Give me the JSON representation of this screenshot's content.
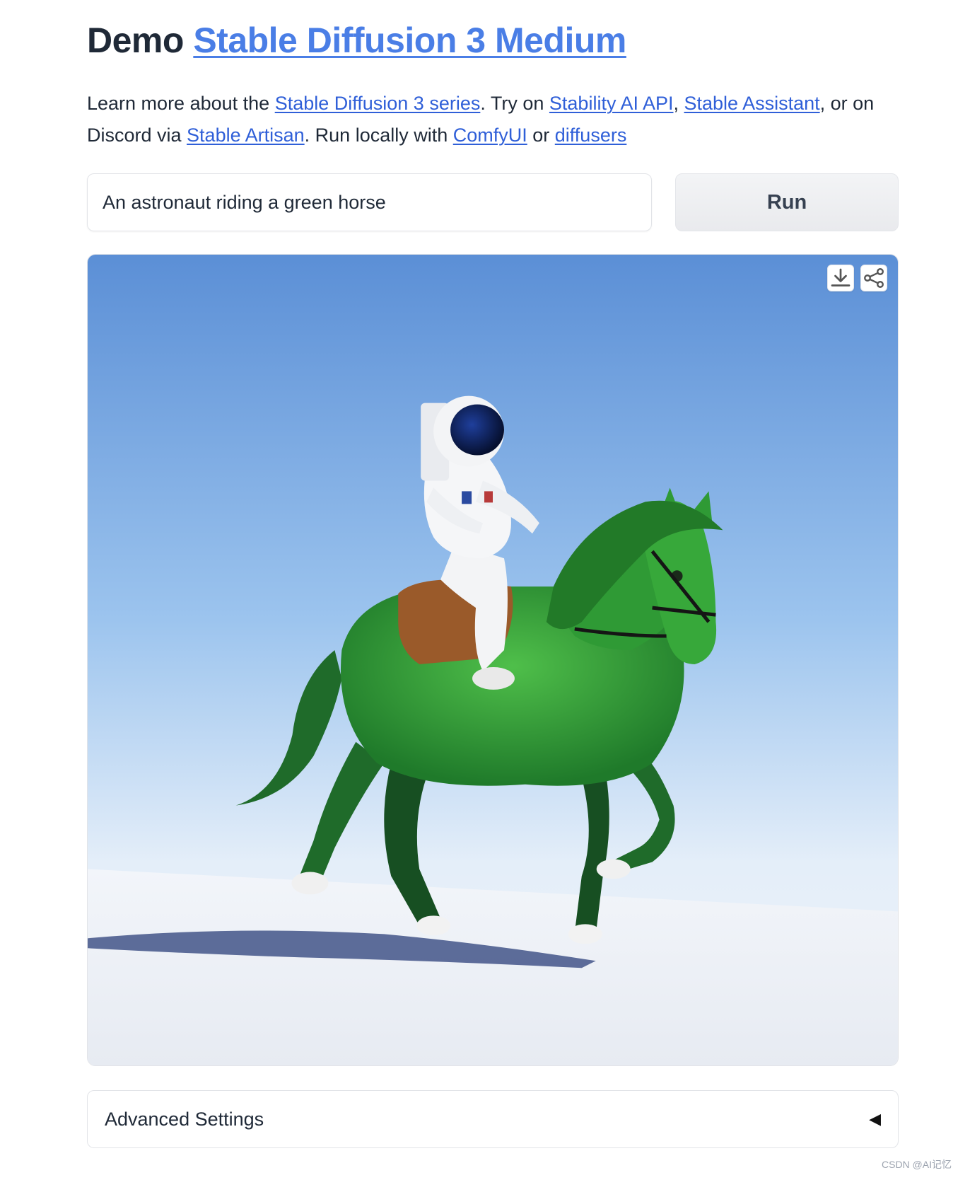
{
  "header": {
    "prefix": "Demo ",
    "link_label": "Stable Diffusion 3 Medium"
  },
  "intro": {
    "t1": "Learn more about the ",
    "link_series": "Stable Diffusion 3 series",
    "t2": ". Try on ",
    "link_api": "Stability AI API",
    "t3": ", ",
    "link_assistant": "Stable Assistant",
    "t4": ", or on Discord via ",
    "link_artisan": "Stable Artisan",
    "t5": ". Run locally with ",
    "link_comfy": "ComfyUI",
    "t6": " or ",
    "link_diffusers": "diffusers"
  },
  "prompt": {
    "value": "An astronaut riding a green horse"
  },
  "run_button": {
    "label": "Run"
  },
  "result": {
    "download_icon": "download-icon",
    "share_icon": "share-icon"
  },
  "advanced_settings": {
    "label": "Advanced Settings",
    "caret": "◀"
  },
  "watermark": "CSDN @AI记忆",
  "colors": {
    "link": "#4a7ee6",
    "sky_top": "#5b8fd6",
    "horse": "#2f9a35",
    "snow": "#f4f6fa"
  }
}
